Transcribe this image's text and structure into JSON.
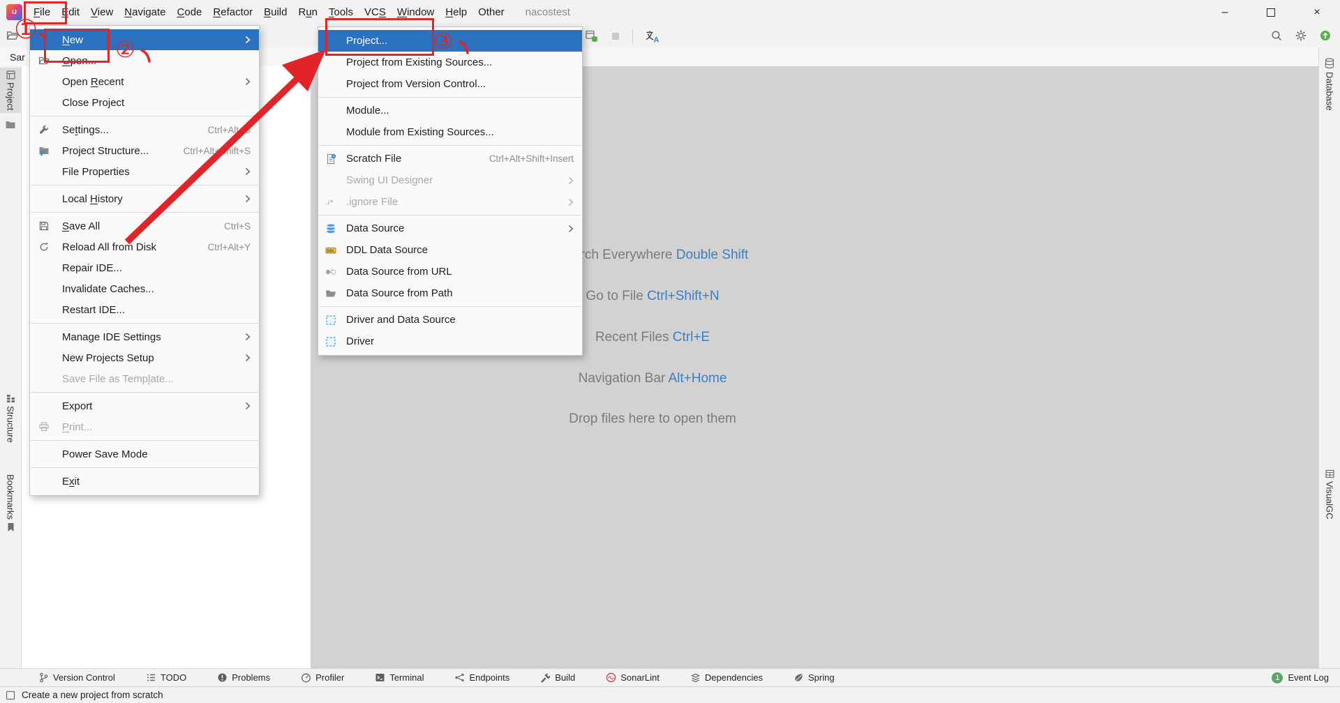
{
  "colors": {
    "selection_blue": "#2a72c0",
    "annotation_red": "#e02428",
    "shortcut_blue": "#3a7fc1",
    "badge_green": "#59a869",
    "editor_bg": "#d2d2d2",
    "bar_bg": "#f2f2f2"
  },
  "titlebar": {
    "logo_text": "IJ",
    "menus": [
      {
        "label": "File",
        "mnemonic": 0
      },
      {
        "label": "Edit",
        "mnemonic": 0
      },
      {
        "label": "View",
        "mnemonic": 0
      },
      {
        "label": "Navigate",
        "mnemonic": 0
      },
      {
        "label": "Code",
        "mnemonic": 0
      },
      {
        "label": "Refactor",
        "mnemonic": 0
      },
      {
        "label": "Build",
        "mnemonic": 0
      },
      {
        "label": "Run",
        "mnemonic": 1
      },
      {
        "label": "Tools",
        "mnemonic": 0
      },
      {
        "label": "VCS",
        "mnemonic": 2
      },
      {
        "label": "Window",
        "mnemonic": 0
      },
      {
        "label": "Help",
        "mnemonic": 0
      },
      {
        "label": "Other"
      }
    ],
    "project_name": "nacostest",
    "window_controls": [
      {
        "name": "minimize-button",
        "icon": "minimize-icon"
      },
      {
        "name": "maximize-button",
        "icon": "maximize-icon"
      },
      {
        "name": "close-button",
        "icon": "close-icon"
      }
    ]
  },
  "toolbar": {
    "left_icons": [
      {
        "icon": "open-project-icon"
      }
    ],
    "center_icons": [
      {
        "icon": "attach-debugger-icon"
      },
      {
        "icon": "stop-icon",
        "disabled": true
      },
      {
        "icon": "separator"
      },
      {
        "icon": "translate-icon"
      }
    ],
    "right_icons": [
      {
        "icon": "search-icon"
      },
      {
        "icon": "gear-icon"
      },
      {
        "icon": "ide-update-icon"
      }
    ]
  },
  "navbar": {
    "breadcrumb": "Sar"
  },
  "left_stripe": {
    "top": [
      {
        "label": "Project",
        "icon": "project-icon",
        "active": true
      },
      {
        "label": "",
        "icon": "folder-icon"
      }
    ],
    "bottom": [
      {
        "label": "Structure",
        "icon": "structure-icon"
      },
      {
        "label": "Bookmarks",
        "icon": "bookmark-icon",
        "icon_after": true
      }
    ]
  },
  "right_stripe": {
    "top": [
      {
        "label": "Database",
        "icon": "database-icon"
      }
    ],
    "bottom": [
      {
        "label": "VisualGC",
        "icon": "visualgc-icon"
      }
    ]
  },
  "file_menu": {
    "items": [
      {
        "label": "New",
        "mnemonic": 0,
        "selected": true,
        "submenu": true
      },
      {
        "label": "Open...",
        "mnemonic": 0,
        "icon": "folder-open-icon"
      },
      {
        "label": "Open Recent",
        "mnemonic": 5,
        "submenu": true
      },
      {
        "label": "Close Project"
      },
      {
        "type": "separator"
      },
      {
        "label": "Settings...",
        "mnemonic": 2,
        "icon": "wrench-icon",
        "shortcut": "Ctrl+Alt+S"
      },
      {
        "label": "Project Structure...",
        "icon": "project-structure-icon",
        "shortcut": "Ctrl+Alt+Shift+S"
      },
      {
        "label": "File Properties",
        "submenu": true
      },
      {
        "type": "separator"
      },
      {
        "label": "Local History",
        "mnemonic": 6,
        "submenu": true
      },
      {
        "type": "separator"
      },
      {
        "label": "Save All",
        "mnemonic": 0,
        "icon": "save-all-icon",
        "shortcut": "Ctrl+S"
      },
      {
        "label": "Reload All from Disk",
        "icon": "reload-icon",
        "shortcut": "Ctrl+Alt+Y"
      },
      {
        "label": "Repair IDE..."
      },
      {
        "label": "Invalidate Caches..."
      },
      {
        "label": "Restart IDE..."
      },
      {
        "type": "separator"
      },
      {
        "label": "Manage IDE Settings",
        "submenu": true
      },
      {
        "label": "New Projects Setup",
        "submenu": true
      },
      {
        "label": "Save File as Template...",
        "mnemonic": 17,
        "disabled": true
      },
      {
        "type": "separator"
      },
      {
        "label": "Export",
        "submenu": true
      },
      {
        "label": "Print...",
        "mnemonic": 0,
        "icon": "printer-icon",
        "disabled": true
      },
      {
        "type": "separator"
      },
      {
        "label": "Power Save Mode"
      },
      {
        "type": "separator"
      },
      {
        "label": "Exit",
        "mnemonic": 1
      }
    ]
  },
  "new_submenu": {
    "items": [
      {
        "label": "Project...",
        "selected": true
      },
      {
        "label": "Project from Existing Sources..."
      },
      {
        "label": "Project from Version Control..."
      },
      {
        "type": "separator"
      },
      {
        "label": "Module..."
      },
      {
        "label": "Module from Existing Sources..."
      },
      {
        "type": "separator"
      },
      {
        "label": "Scratch File",
        "icon": "scratch-file-icon",
        "shortcut": "Ctrl+Alt+Shift+Insert"
      },
      {
        "label": "Swing UI Designer",
        "disabled": true,
        "submenu": true
      },
      {
        "label": ".ignore File",
        "icon": "ignore-file-icon",
        "disabled": true,
        "submenu": true
      },
      {
        "type": "separator"
      },
      {
        "label": "Data Source",
        "icon": "data-source-icon",
        "submenu": true
      },
      {
        "label": "DDL Data Source",
        "icon": "ddl-data-source-icon"
      },
      {
        "label": "Data Source from URL",
        "icon": "data-source-url-icon"
      },
      {
        "label": "Data Source from Path",
        "icon": "data-source-path-icon"
      },
      {
        "type": "separator"
      },
      {
        "label": "Driver and Data Source",
        "icon": "driver-data-source-icon"
      },
      {
        "label": "Driver",
        "icon": "driver-icon"
      }
    ]
  },
  "editor_hints": [
    {
      "label": "Search Everywhere",
      "shortcut": "Double Shift"
    },
    {
      "label": "Go to File",
      "shortcut": "Ctrl+Shift+N"
    },
    {
      "label": "Recent Files",
      "shortcut": "Ctrl+E"
    },
    {
      "label": "Navigation Bar",
      "shortcut": "Alt+Home"
    },
    {
      "label": "Drop files here to open them",
      "shortcut": ""
    }
  ],
  "bottom_bar": {
    "items": [
      {
        "label": "Version Control",
        "icon": "version-control-icon"
      },
      {
        "label": "TODO",
        "icon": "todo-icon"
      },
      {
        "label": "Problems",
        "icon": "problems-icon"
      },
      {
        "label": "Profiler",
        "icon": "profiler-icon"
      },
      {
        "label": "Terminal",
        "icon": "terminal-icon"
      },
      {
        "label": "Endpoints",
        "icon": "endpoints-icon"
      },
      {
        "label": "Build",
        "icon": "build-icon"
      },
      {
        "label": "SonarLint",
        "icon": "sonarlint-icon"
      },
      {
        "label": "Dependencies",
        "icon": "dependencies-icon"
      },
      {
        "label": "Spring",
        "icon": "spring-icon"
      }
    ],
    "event_log": {
      "label": "Event Log",
      "badge": "1",
      "icon": "event-log-badge"
    }
  },
  "status_bar": {
    "message": "Create a new project from scratch",
    "icon": "new-project-icon"
  },
  "annotations": {
    "step1": "①",
    "step2": "②",
    "step3": "③"
  }
}
